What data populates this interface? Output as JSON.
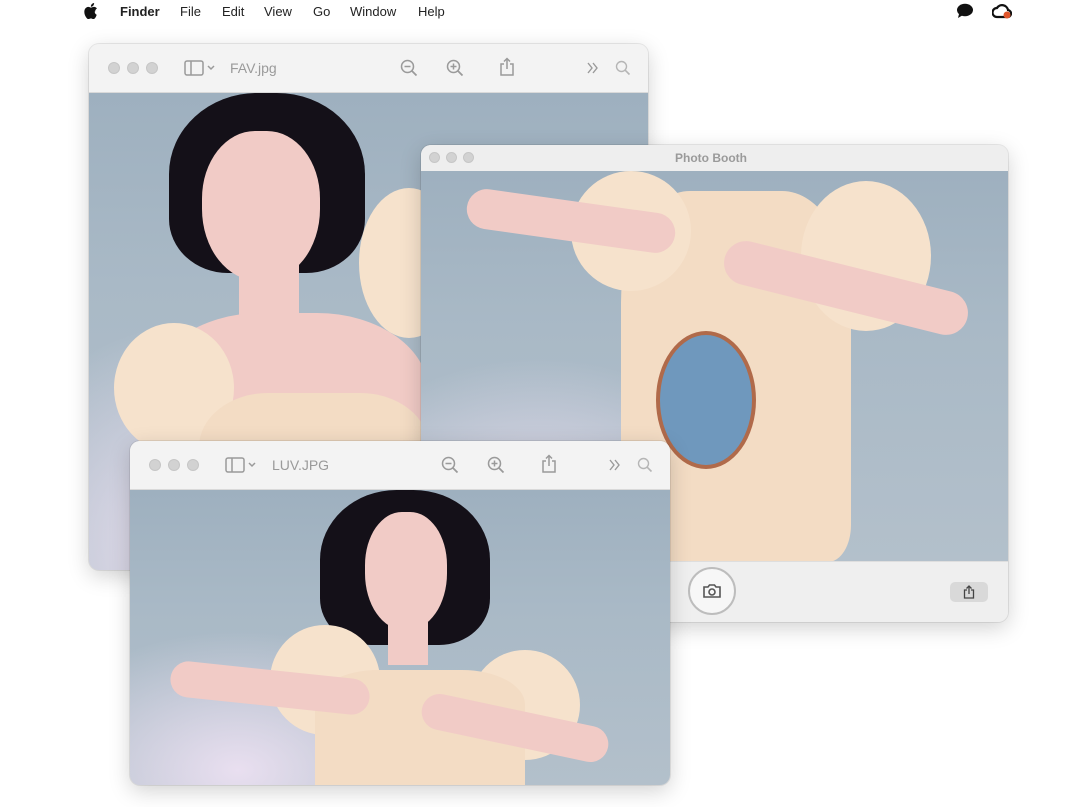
{
  "menubar": {
    "app_name": "Finder",
    "items": [
      "File",
      "Edit",
      "View",
      "Go",
      "Window",
      "Help"
    ],
    "status_icons": [
      "messages-icon",
      "creative-cloud-icon"
    ]
  },
  "windows": {
    "fav": {
      "title": "FAV.jpg"
    },
    "photobooth": {
      "title": "Photo Booth"
    },
    "luv": {
      "title": "LUV.JPG"
    }
  },
  "toolbar_icons": [
    "sidebar-toggle-icon",
    "chevron-down-icon",
    "zoom-out-icon",
    "zoom-in-icon",
    "share-icon",
    "more-chevron-icon",
    "search-icon"
  ],
  "colors": {
    "menubar_bg": "#ffffff",
    "window_chrome": "#ededed",
    "traffic_light": "#d2d2d2",
    "studio_bg": "#a9b9c6"
  }
}
